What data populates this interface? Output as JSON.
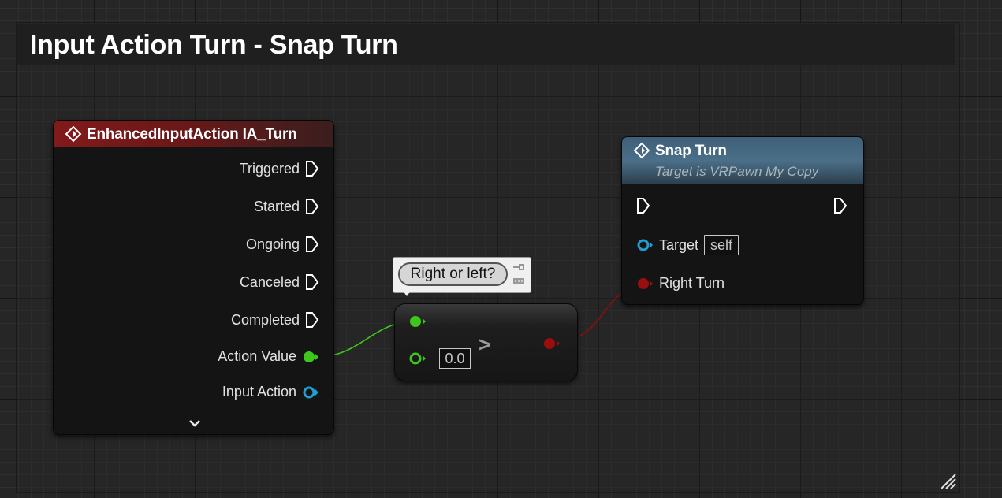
{
  "comment": {
    "title": "Input Action Turn - Snap Turn"
  },
  "input_action_node": {
    "title": "EnhancedInputAction IA_Turn",
    "header_color": "#821a1a",
    "exec_pins": [
      "Triggered",
      "Started",
      "Ongoing",
      "Canceled",
      "Completed"
    ],
    "action_value_label": "Action Value",
    "input_action_label": "Input Action"
  },
  "compare_node": {
    "operator": ">",
    "b_value": "0.0",
    "comment_bubble": "Right or left?"
  },
  "snap_turn_node": {
    "title": "Snap Turn",
    "subtitle": "Target is VRPawn My Copy",
    "header_color": "#4b6f88",
    "target_label": "Target",
    "target_value": "self",
    "right_turn_label": "Right Turn"
  },
  "colors": {
    "float_pin": "#3ec71a",
    "bool_pin": "#9a0e0e",
    "object_pin": "#1f9fd6",
    "exec_pin": "#ffffff"
  }
}
